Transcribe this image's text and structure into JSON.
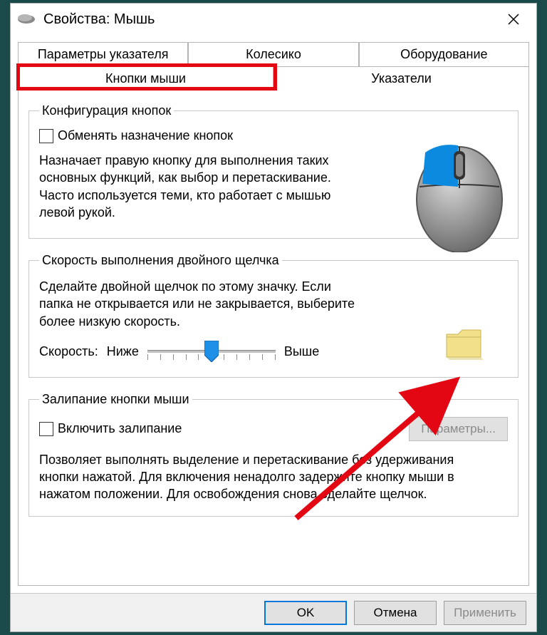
{
  "window": {
    "title": "Свойства: Мышь"
  },
  "tabs": {
    "row1": [
      "Параметры указателя",
      "Колесико",
      "Оборудование"
    ],
    "row2": [
      "Кнопки мыши",
      "Указатели"
    ],
    "active": "Кнопки мыши"
  },
  "group1": {
    "legend": "Конфигурация кнопок",
    "checkbox_label": "Обменять назначение кнопок",
    "desc": "Назначает правую кнопку для выполнения таких основных функций, как выбор и перетаскивание. Часто используется теми, кто работает с мышью левой рукой."
  },
  "group2": {
    "legend": "Скорость выполнения двойного щелчка",
    "desc": "Сделайте двойной щелчок по этому значку. Если папка не открывается или не закрывается, выберите более низкую скорость.",
    "speed_label": "Скорость:",
    "low": "Ниже",
    "high": "Выше"
  },
  "group3": {
    "legend": "Залипание кнопки мыши",
    "checkbox_label": "Включить залипание",
    "params_button": "Параметры...",
    "desc": "Позволяет выполнять выделение и перетаскивание без удерживания кнопки нажатой. Для включения ненадолго задержите кнопку мыши в нажатом положении. Для освобождения снова сделайте щелчок."
  },
  "footer": {
    "ok": "OK",
    "cancel": "Отмена",
    "apply": "Применить"
  },
  "annotations": {
    "highlight_tab": "Кнопки мыши",
    "arrow_target": "folder-icon"
  }
}
